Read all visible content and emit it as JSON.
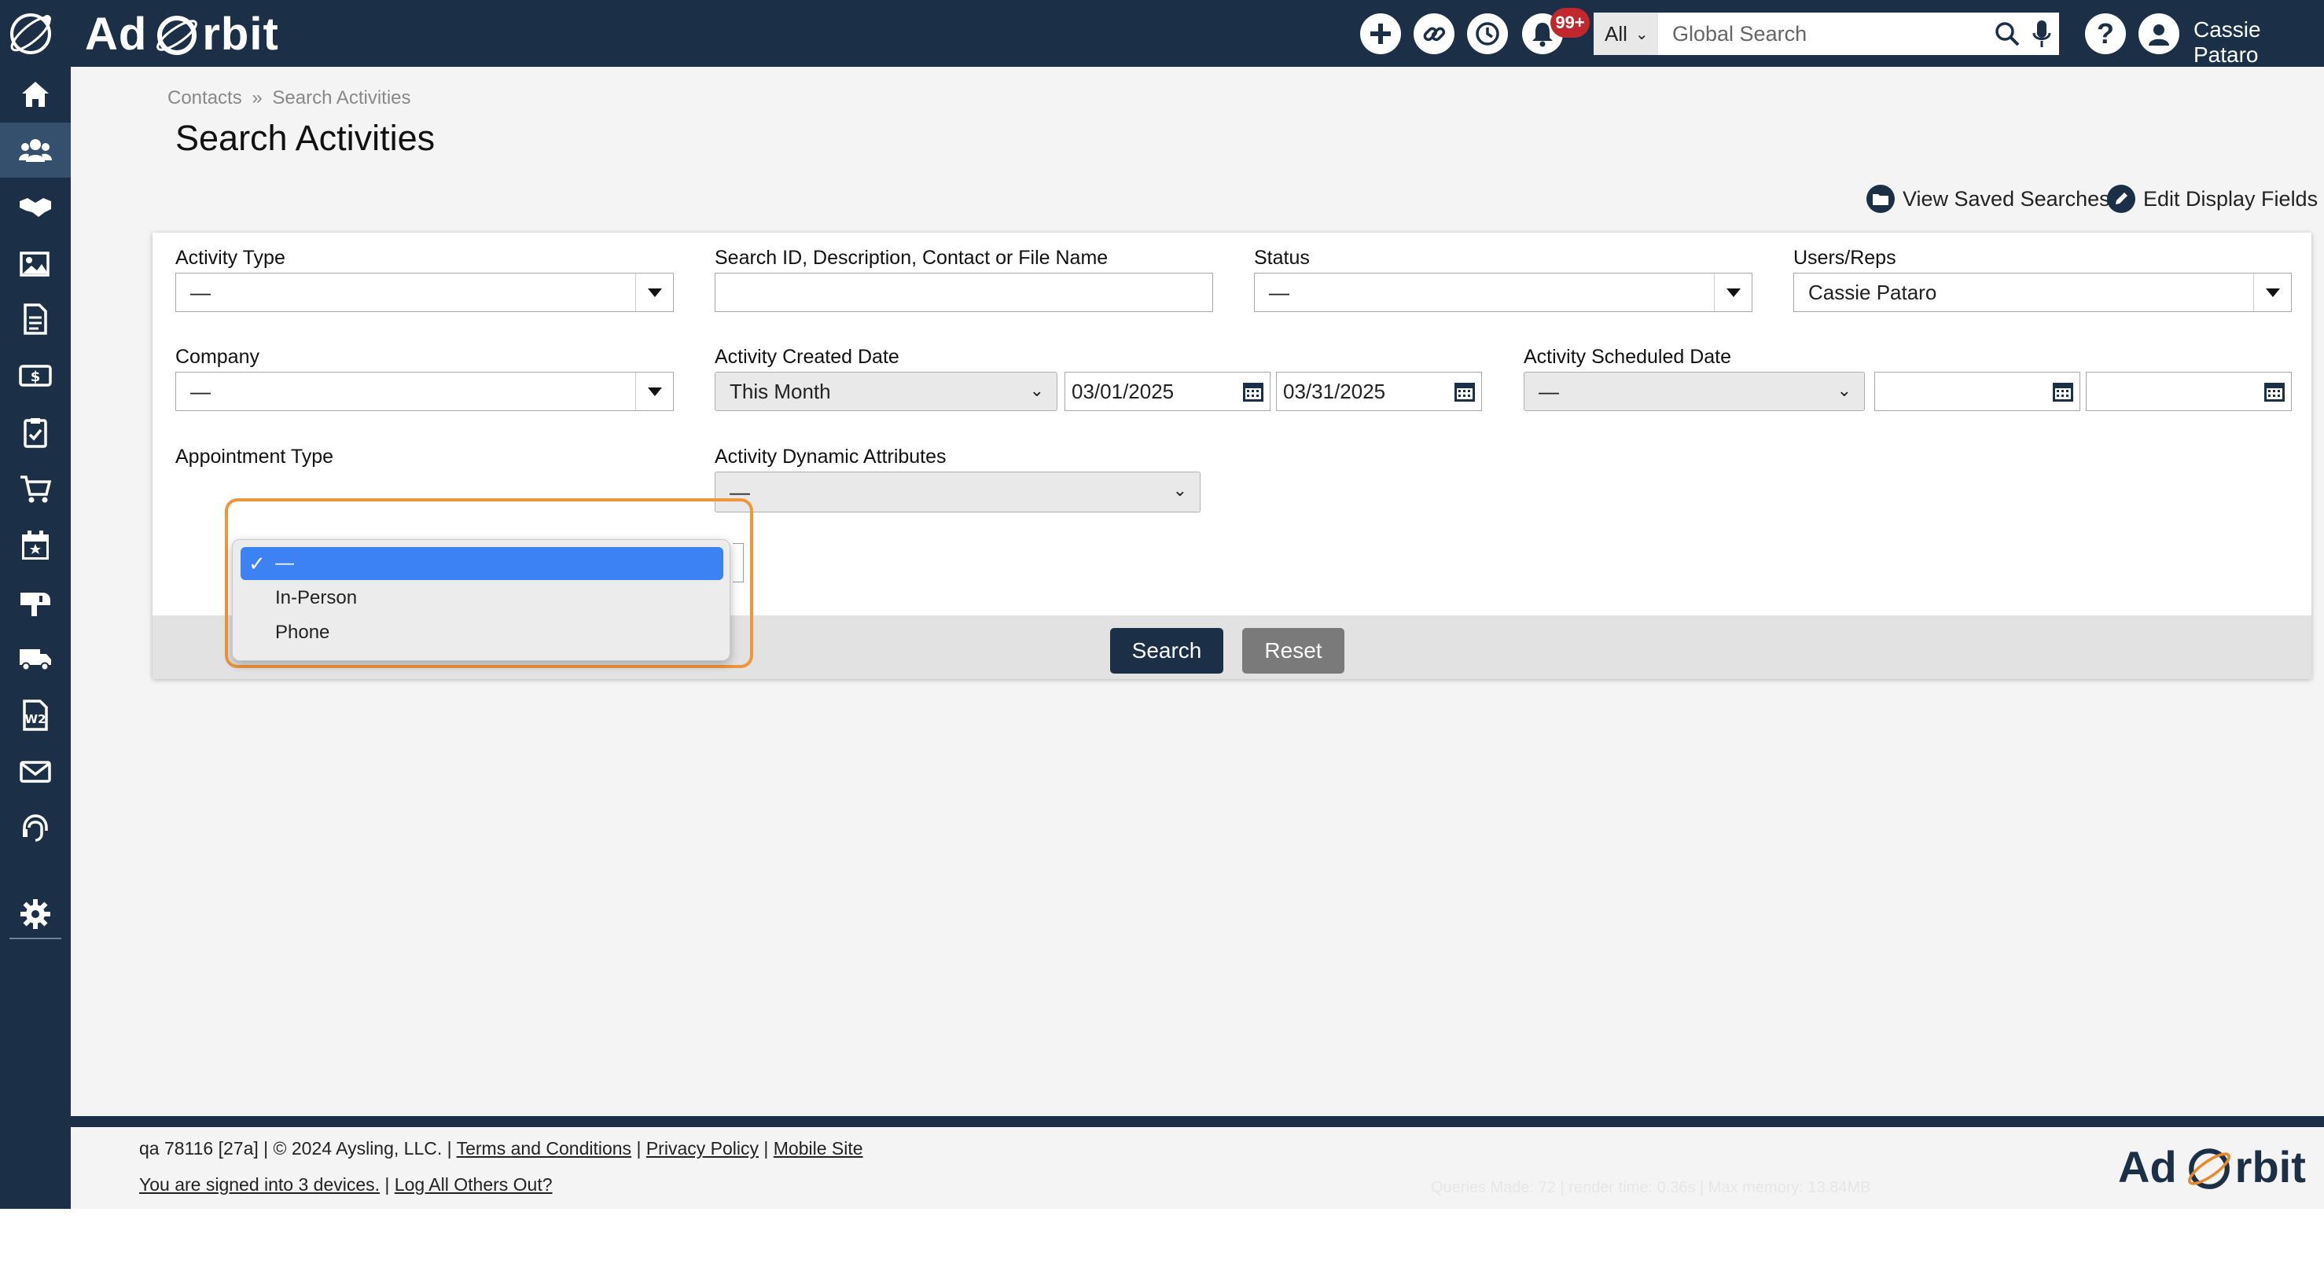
{
  "brand": {
    "name_left": "Ad",
    "name_right": "rbit",
    "accent": "#e8892b"
  },
  "topbar": {
    "icons": [
      "plus-icon",
      "link-icon",
      "history-icon",
      "bell-icon"
    ],
    "notification_count": "99+",
    "search_scope": "All",
    "search_placeholder": "Global Search",
    "user_name": "Cassie Pataro"
  },
  "sidebar": {
    "items": [
      {
        "name": "home",
        "icon": "home-icon"
      },
      {
        "name": "contacts",
        "icon": "users-icon",
        "active": true
      },
      {
        "name": "deals",
        "icon": "handshake-icon"
      },
      {
        "name": "media",
        "icon": "image-icon"
      },
      {
        "name": "invoices",
        "icon": "invoice-icon"
      },
      {
        "name": "finance",
        "icon": "money-icon"
      },
      {
        "name": "tasks",
        "icon": "clipboard-icon"
      },
      {
        "name": "orders",
        "icon": "cart-icon"
      },
      {
        "name": "calendar",
        "icon": "calendar-icon"
      },
      {
        "name": "mail",
        "icon": "mailbox-icon"
      },
      {
        "name": "delivery",
        "icon": "truck-icon"
      },
      {
        "name": "w2",
        "icon": "w2-icon"
      },
      {
        "name": "email",
        "icon": "envelope-icon"
      },
      {
        "name": "support",
        "icon": "headset-icon"
      },
      {
        "name": "settings",
        "icon": "gear-icon"
      }
    ]
  },
  "breadcrumb": {
    "root": "Contacts",
    "separator": "»",
    "current": "Search Activities"
  },
  "page_title": "Search Activities",
  "actions": {
    "view_saved": "View Saved Searches",
    "edit_display": "Edit Display Fields"
  },
  "form": {
    "activity_type": {
      "label": "Activity Type",
      "value": "—"
    },
    "search_id": {
      "label": "Search ID, Description, Contact or File Name",
      "value": ""
    },
    "status": {
      "label": "Status",
      "value": "—"
    },
    "users_reps": {
      "label": "Users/Reps",
      "value": "Cassie Pataro"
    },
    "company": {
      "label": "Company",
      "value": "—"
    },
    "created_date": {
      "label": "Activity Created Date",
      "range": "This Month",
      "from": "03/01/2025",
      "to": "03/31/2025"
    },
    "scheduled_date": {
      "label": "Activity Scheduled Date",
      "range": "—",
      "from": "",
      "to": ""
    },
    "appointment_type": {
      "label": "Appointment Type",
      "options": [
        "—",
        "In-Person",
        "Phone"
      ],
      "selected": "—"
    },
    "dynamic_attributes": {
      "label": "Activity Dynamic Attributes",
      "value": "—"
    }
  },
  "buttons": {
    "search": "Search",
    "reset": "Reset"
  },
  "footer": {
    "version": "qa 78116 [27a]",
    "copyright": "| © 2024 Aysling, LLC. |",
    "terms": "Terms and Conditions",
    "privacy": "Privacy Policy",
    "mobile": "Mobile Site",
    "pipe": "|",
    "devices": "You are signed into 3 devices.",
    "logout_others": "Log All Others Out?",
    "faint_stats": "Queries Made: 72 | render time: 0.36s | Max memory: 13.84MB"
  },
  "colors": {
    "navy": "#1b3047",
    "highlight": "#f0963a",
    "selected_option": "#3d82f5",
    "badge": "#c0282d"
  }
}
